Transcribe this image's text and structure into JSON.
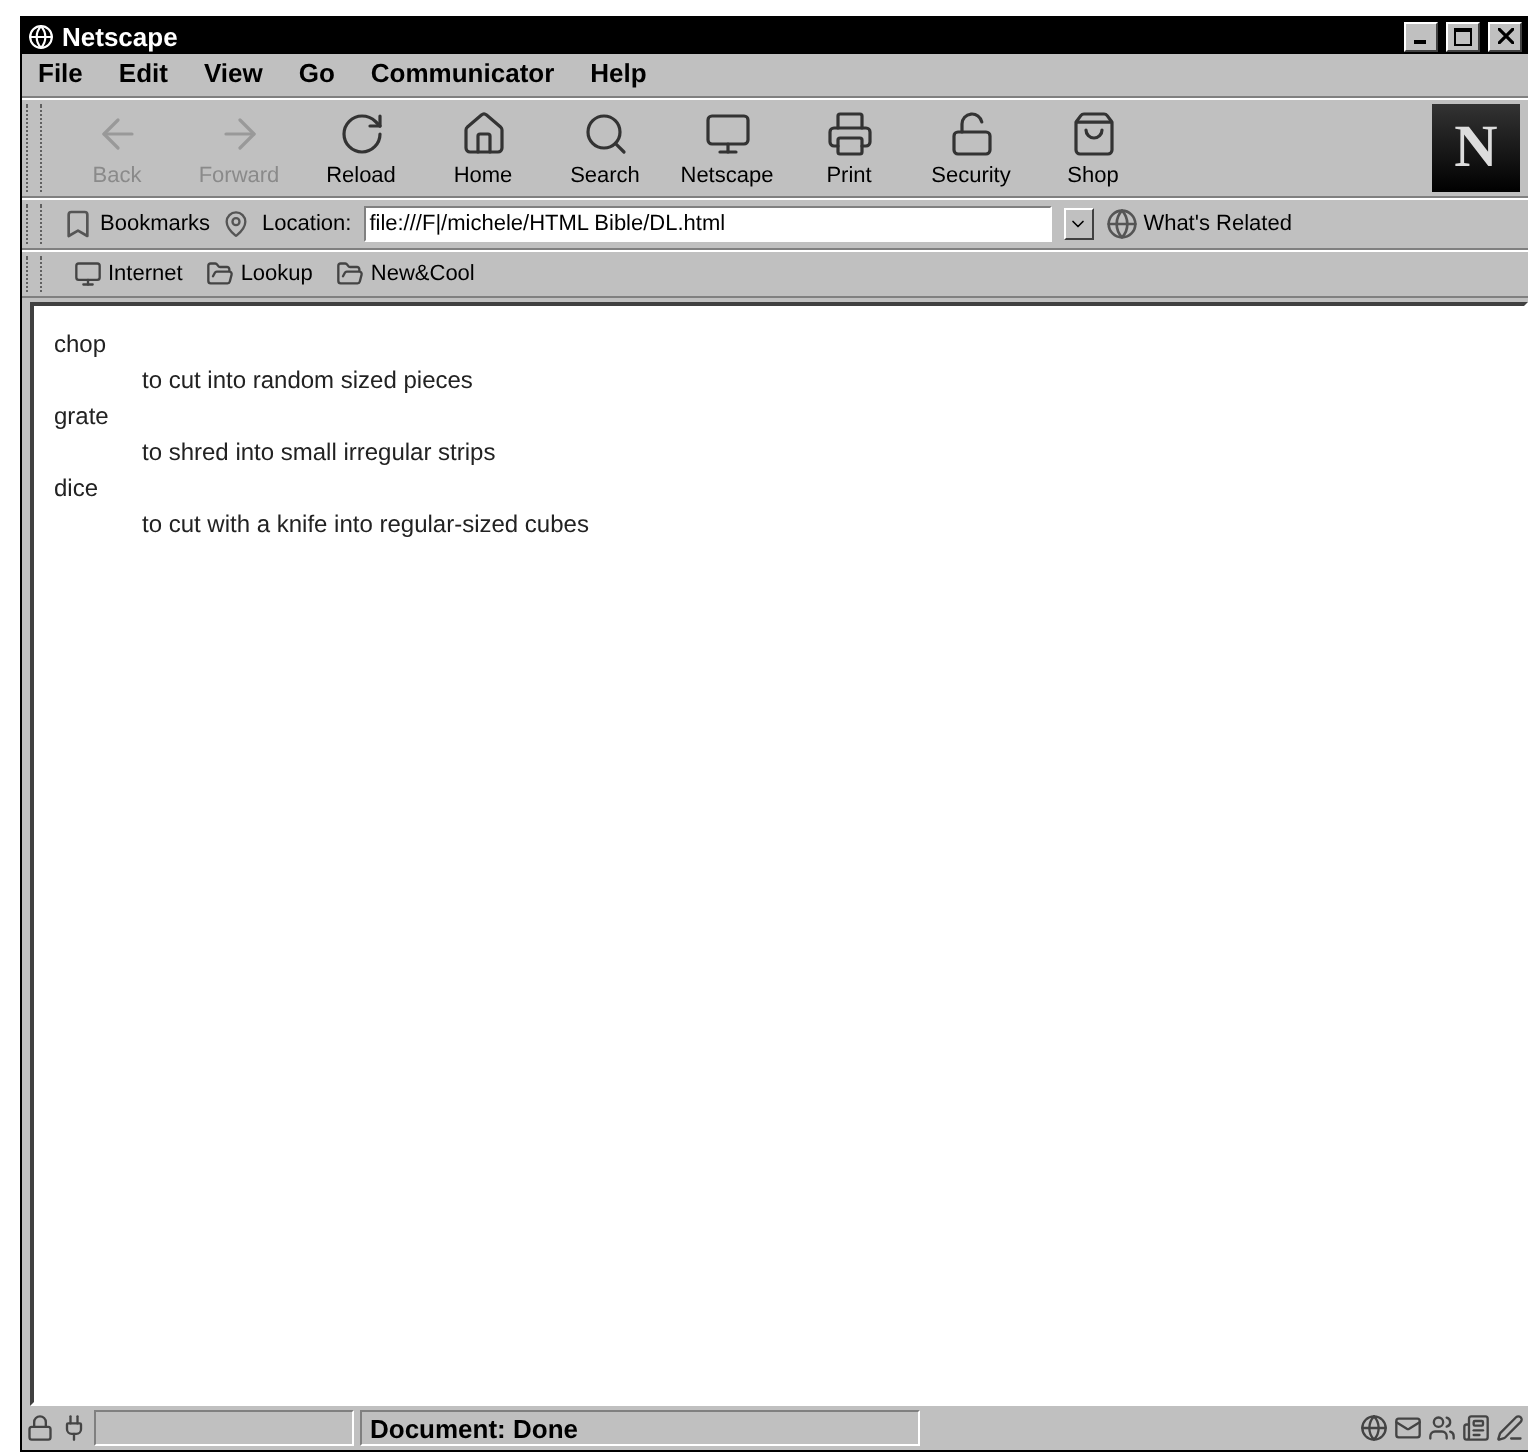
{
  "window": {
    "title": "Netscape"
  },
  "menu": [
    "File",
    "Edit",
    "View",
    "Go",
    "Communicator",
    "Help"
  ],
  "toolbar": [
    {
      "kind": "back",
      "label": "Back",
      "disabled": true
    },
    {
      "kind": "forward",
      "label": "Forward",
      "disabled": true
    },
    {
      "kind": "reload",
      "label": "Reload",
      "disabled": false
    },
    {
      "kind": "home",
      "label": "Home",
      "disabled": false
    },
    {
      "kind": "search",
      "label": "Search",
      "disabled": false
    },
    {
      "kind": "netscape",
      "label": "Netscape",
      "disabled": false
    },
    {
      "kind": "print",
      "label": "Print",
      "disabled": false
    },
    {
      "kind": "security",
      "label": "Security",
      "disabled": false
    },
    {
      "kind": "shop",
      "label": "Shop",
      "disabled": false
    }
  ],
  "brand_logo": "N",
  "location_bar": {
    "bookmarks": "Bookmarks",
    "location_label": "Location:",
    "url": "file:///F|/michele/HTML Bible/DL.html",
    "whats_related": "What's Related"
  },
  "personal_toolbar": [
    "Internet",
    "Lookup",
    "New&Cool"
  ],
  "content": {
    "definitions": [
      {
        "term": "chop",
        "definition": "to cut into random sized pieces"
      },
      {
        "term": "grate",
        "definition": "to shred into small irregular strips"
      },
      {
        "term": "dice",
        "definition": "to cut with a knife into regular-sized cubes"
      }
    ]
  },
  "status_bar": {
    "message": "Document: Done"
  }
}
